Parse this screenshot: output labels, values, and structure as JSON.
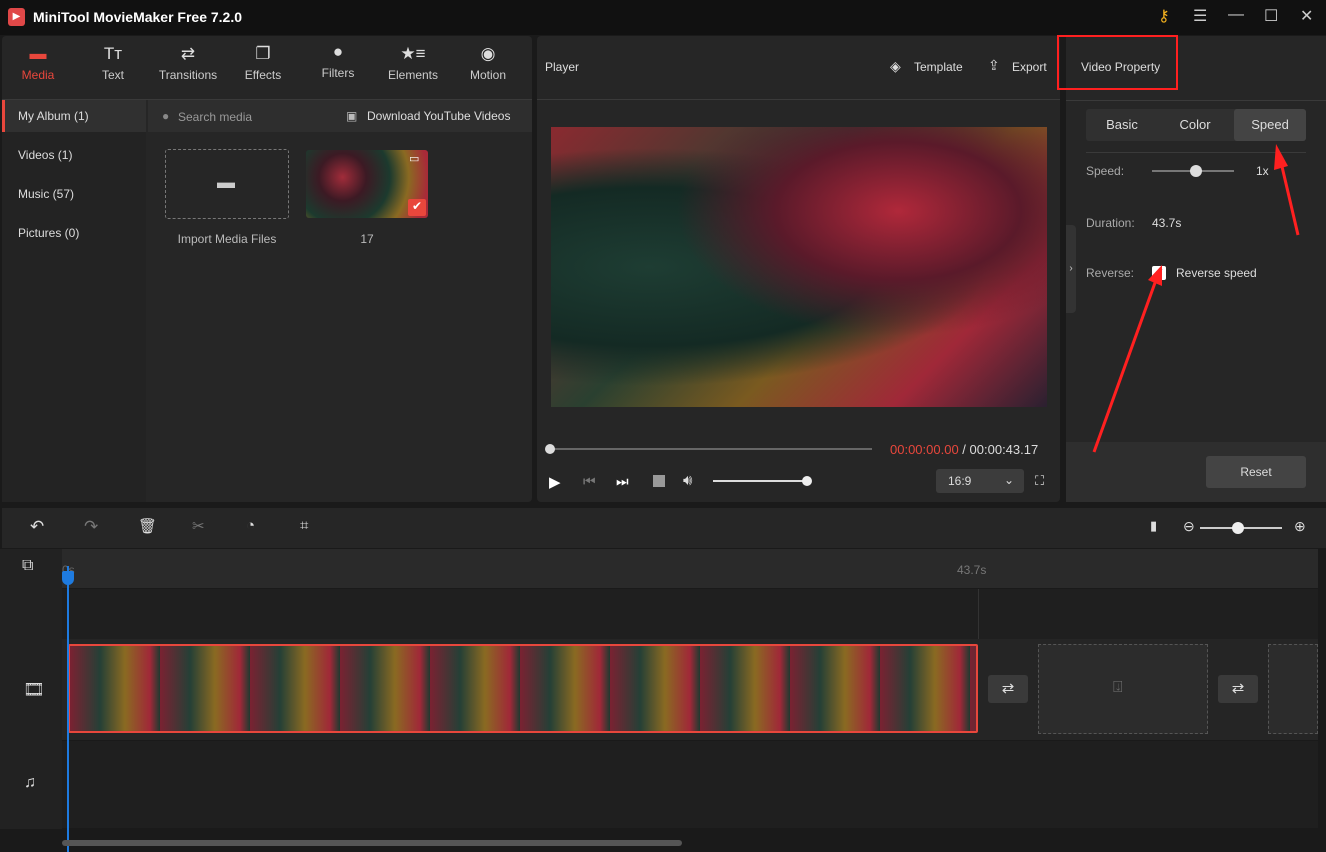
{
  "app": {
    "title": "MiniTool MovieMaker Free 7.2.0"
  },
  "toolbar": {
    "tabs": [
      {
        "label": "Media",
        "icon": "folder-icon"
      },
      {
        "label": "Text",
        "icon": "text-icon"
      },
      {
        "label": "Transitions",
        "icon": "transitions-icon"
      },
      {
        "label": "Effects",
        "icon": "effects-icon"
      },
      {
        "label": "Filters",
        "icon": "filters-icon"
      },
      {
        "label": "Elements",
        "icon": "elements-icon"
      },
      {
        "label": "Motion",
        "icon": "motion-icon"
      }
    ]
  },
  "sidebar": {
    "items": [
      {
        "label": "My Album (1)"
      },
      {
        "label": "Videos (1)"
      },
      {
        "label": "Music (57)"
      },
      {
        "label": "Pictures (0)"
      }
    ]
  },
  "media": {
    "search_placeholder": "Search media",
    "download": "Download YouTube Videos",
    "import_label": "Import Media Files",
    "clip_label": "17"
  },
  "player": {
    "title": "Player",
    "template": "Template",
    "export": "Export",
    "current_time": "00:00:00.00",
    "separator": " / ",
    "total_time": "00:00:43.17",
    "aspect": "16:9",
    "volume": 0.95,
    "progress": 0
  },
  "property": {
    "title": "Video Property",
    "tabs": [
      "Basic",
      "Color",
      "Speed"
    ],
    "active_tab": "Speed",
    "speed_label": "Speed:",
    "speed_value": "1x",
    "duration_label": "Duration:",
    "duration_value": "43.7s",
    "reverse_label": "Reverse:",
    "reverse_option": "Reverse speed",
    "reverse_checked": true,
    "reset": "Reset"
  },
  "timeline": {
    "start": "0s",
    "end": "43.7s",
    "zoom": 0.6
  },
  "colors": {
    "accent": "#e8473c",
    "annotation": "#ff2020",
    "playhead": "#1e7be0"
  }
}
